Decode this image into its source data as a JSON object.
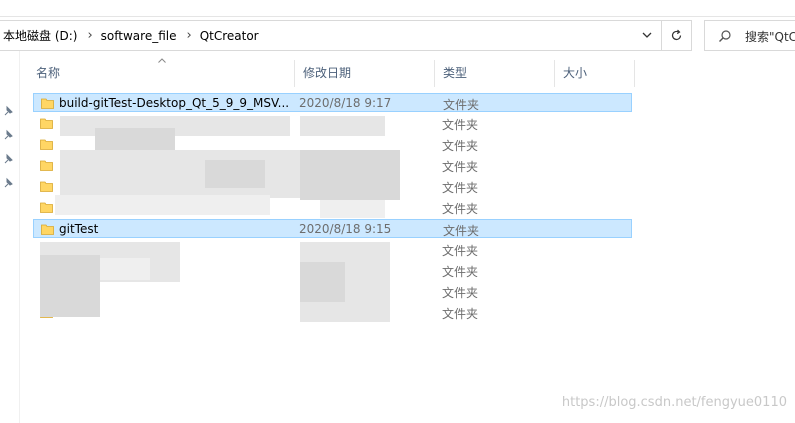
{
  "address": {
    "crumbs": [
      "本地磁盘 (D:)",
      "software_file",
      "QtCreator"
    ],
    "separator": "›"
  },
  "search": {
    "placeholder": "搜索\"QtC"
  },
  "columns": {
    "name": "名称",
    "date": "修改日期",
    "type": "类型",
    "size": "大小"
  },
  "files": [
    {
      "name": "build-gitTest-Desktop_Qt_5_9_9_MSV...",
      "date": "2020/8/18 9:17",
      "type": "文件夹",
      "selected": true
    },
    {
      "name": "",
      "date": "",
      "type": "文件夹",
      "selected": false
    },
    {
      "name": "",
      "date": "",
      "type": "文件夹",
      "selected": false
    },
    {
      "name": "",
      "date": "",
      "type": "文件夹",
      "selected": false
    },
    {
      "name": "",
      "date": "",
      "type": "文件夹",
      "selected": false
    },
    {
      "name": "",
      "date": "",
      "type": "文件夹",
      "selected": false
    },
    {
      "name": "gitTest",
      "date": "2020/8/18 9:15",
      "type": "文件夹",
      "selected": true
    },
    {
      "name": "",
      "date": "",
      "type": "文件夹",
      "selected": false
    },
    {
      "name": "",
      "date": "",
      "type": "文件夹",
      "selected": false
    },
    {
      "name": "",
      "date": "",
      "type": "文件夹",
      "selected": false
    },
    {
      "name": "",
      "date": "",
      "type": "文件夹",
      "selected": false
    }
  ],
  "watermark": "https://blog.csdn.net/fengyue0110",
  "colors": {
    "selection": "#cce8ff",
    "selection_border": "#99d1ff",
    "folder": "#ffd664",
    "header_text": "#4c607a"
  }
}
